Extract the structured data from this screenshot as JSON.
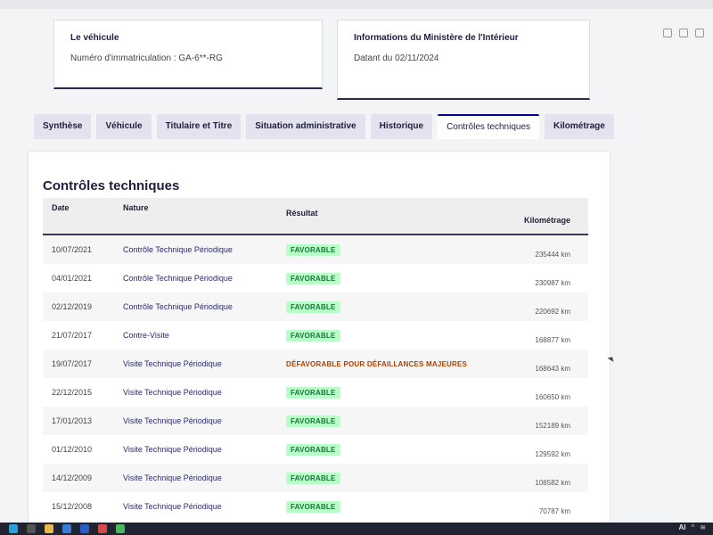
{
  "vehicle_card": {
    "title": "Le véhicule",
    "registration": "Numéro d'immatriculation : GA-6**-RG"
  },
  "ministry_card": {
    "title": "Informations du Ministère de l'Intérieur",
    "date": "Datant du 02/11/2024"
  },
  "tabs": [
    {
      "label": "Synthèse",
      "active": false
    },
    {
      "label": "Véhicule",
      "active": false
    },
    {
      "label": "Titulaire et Titre",
      "active": false
    },
    {
      "label": "Situation administrative",
      "active": false
    },
    {
      "label": "Historique",
      "active": false
    },
    {
      "label": "Contrôles techniques",
      "active": true
    },
    {
      "label": "Kilométrage",
      "active": false
    }
  ],
  "section": {
    "title": "Contrôles techniques"
  },
  "table": {
    "headers": {
      "date": "Date",
      "nature": "Nature",
      "result": "Résultat",
      "km": "Kilométrage"
    },
    "rows": [
      {
        "date": "10/07/2021",
        "nature": "Contrôle Technique Périodique",
        "result": "FAVORABLE",
        "status": "ok",
        "km": "235444 km"
      },
      {
        "date": "04/01/2021",
        "nature": "Contrôle Technique Périodique",
        "result": "FAVORABLE",
        "status": "ok",
        "km": "230987 km"
      },
      {
        "date": "02/12/2019",
        "nature": "Contrôle Technique Périodique",
        "result": "FAVORABLE",
        "status": "ok",
        "km": "220692 km"
      },
      {
        "date": "21/07/2017",
        "nature": "Contre-Visite",
        "result": "FAVORABLE",
        "status": "ok",
        "km": "168877 km"
      },
      {
        "date": "19/07/2017",
        "nature": "Visite Technique Périodique",
        "result": "DÉFAVORABLE POUR DÉFAILLANCES MAJEURES",
        "status": "ko",
        "km": "168643 km"
      },
      {
        "date": "22/12/2015",
        "nature": "Visite Technique Périodique",
        "result": "FAVORABLE",
        "status": "ok",
        "km": "160650 km"
      },
      {
        "date": "17/01/2013",
        "nature": "Visite Technique Périodique",
        "result": "FAVORABLE",
        "status": "ok",
        "km": "152189 km"
      },
      {
        "date": "01/12/2010",
        "nature": "Visite Technique Périodique",
        "result": "FAVORABLE",
        "status": "ok",
        "km": "129592 km"
      },
      {
        "date": "14/12/2009",
        "nature": "Visite Technique Périodique",
        "result": "FAVORABLE",
        "status": "ok",
        "km": "106582 km"
      },
      {
        "date": "15/12/2008",
        "nature": "Visite Technique Périodique",
        "result": "FAVORABLE",
        "status": "ok",
        "km": "70787 km"
      }
    ]
  },
  "taskbar": {
    "ai_label": "AI"
  },
  "colors": {
    "ok_bg": "#b8fec9",
    "ok_text": "#18753c",
    "ko_text": "#b34000",
    "accent": "#000091"
  }
}
